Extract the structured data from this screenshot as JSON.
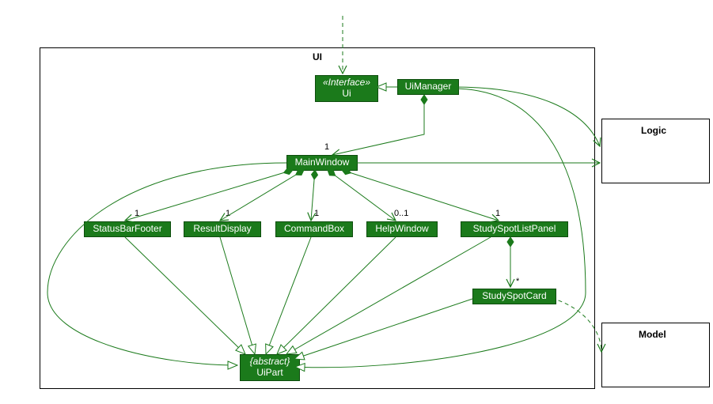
{
  "packages": {
    "ui": {
      "label": "UI"
    },
    "logic": {
      "label": "Logic"
    },
    "model": {
      "label": "Model"
    }
  },
  "classes": {
    "uiInterface": {
      "stereotype": "«Interface»",
      "name": "Ui"
    },
    "uiManager": {
      "name": "UiManager"
    },
    "mainWindow": {
      "name": "MainWindow"
    },
    "statusBarFooter": {
      "name": "StatusBarFooter"
    },
    "resultDisplay": {
      "name": "ResultDisplay"
    },
    "commandBox": {
      "name": "CommandBox"
    },
    "helpWindow": {
      "name": "HelpWindow"
    },
    "studySpotListPanel": {
      "name": "StudySpotListPanel"
    },
    "studySpotCard": {
      "name": "StudySpotCard"
    },
    "uiPart": {
      "stereotype": "{abstract}",
      "name": "UiPart"
    }
  },
  "multiplicities": {
    "mainWindow": "1",
    "statusBarFooter": "1",
    "resultDisplay": "1",
    "commandBox": "1",
    "helpWindow": "0..1",
    "studySpotListPanel": "1",
    "studySpotCard": "*"
  },
  "chart_data": {
    "type": "diagram",
    "diagram_kind": "uml-class",
    "packages": [
      "UI",
      "Logic",
      "Model"
    ],
    "classes": [
      {
        "name": "Ui",
        "stereotype": "Interface",
        "package": "UI"
      },
      {
        "name": "UiManager",
        "package": "UI"
      },
      {
        "name": "MainWindow",
        "package": "UI"
      },
      {
        "name": "StatusBarFooter",
        "package": "UI"
      },
      {
        "name": "ResultDisplay",
        "package": "UI"
      },
      {
        "name": "CommandBox",
        "package": "UI"
      },
      {
        "name": "HelpWindow",
        "package": "UI"
      },
      {
        "name": "StudySpotListPanel",
        "package": "UI"
      },
      {
        "name": "StudySpotCard",
        "package": "UI"
      },
      {
        "name": "UiPart",
        "stereotype": "abstract",
        "package": "UI"
      }
    ],
    "relationships": [
      {
        "from": "UiManager",
        "to": "Ui",
        "type": "realization"
      },
      {
        "from": "MainWindow",
        "to": "UiPart",
        "type": "inheritance"
      },
      {
        "from": "StatusBarFooter",
        "to": "UiPart",
        "type": "inheritance"
      },
      {
        "from": "ResultDisplay",
        "to": "UiPart",
        "type": "inheritance"
      },
      {
        "from": "CommandBox",
        "to": "UiPart",
        "type": "inheritance"
      },
      {
        "from": "HelpWindow",
        "to": "UiPart",
        "type": "inheritance"
      },
      {
        "from": "StudySpotListPanel",
        "to": "UiPart",
        "type": "inheritance"
      },
      {
        "from": "StudySpotCard",
        "to": "UiPart",
        "type": "inheritance"
      },
      {
        "from": "UiManager",
        "to": "UiPart",
        "type": "inheritance"
      },
      {
        "from": "UiManager",
        "to": "MainWindow",
        "type": "composition",
        "multiplicity": "1"
      },
      {
        "from": "MainWindow",
        "to": "StatusBarFooter",
        "type": "composition",
        "multiplicity": "1"
      },
      {
        "from": "MainWindow",
        "to": "ResultDisplay",
        "type": "composition",
        "multiplicity": "1"
      },
      {
        "from": "MainWindow",
        "to": "CommandBox",
        "type": "composition",
        "multiplicity": "1"
      },
      {
        "from": "MainWindow",
        "to": "HelpWindow",
        "type": "composition",
        "multiplicity": "0..1"
      },
      {
        "from": "MainWindow",
        "to": "StudySpotListPanel",
        "type": "composition",
        "multiplicity": "1"
      },
      {
        "from": "StudySpotListPanel",
        "to": "StudySpotCard",
        "type": "composition",
        "multiplicity": "*"
      },
      {
        "from": "(external)",
        "to": "Ui",
        "type": "dependency"
      },
      {
        "from": "MainWindow",
        "to": "Logic",
        "type": "association-directed"
      },
      {
        "from": "UiManager",
        "to": "Logic",
        "type": "association-directed"
      },
      {
        "from": "StudySpotCard",
        "to": "Model",
        "type": "dependency"
      }
    ]
  }
}
